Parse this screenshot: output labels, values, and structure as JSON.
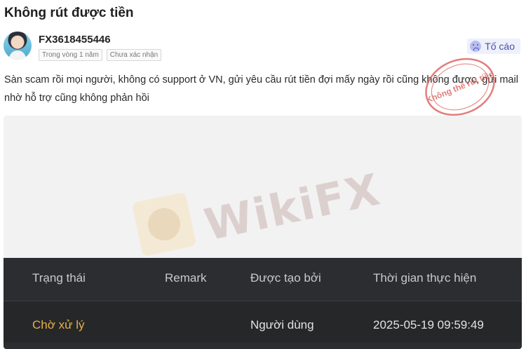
{
  "post": {
    "title": "Không rút được tiền",
    "username": "FX3618455446",
    "tags": [
      "Trong vòng 1 năm",
      "Chưa xác nhận"
    ],
    "report_label": "Tố cáo",
    "report_icon": "sad-face-icon",
    "body": "Sàn scam rồi mọi người, không có support ở VN, gửi yêu cầu rút tiền đợi mấy ngày rồi cũng không được, gửi mail nhờ hỗ trợ cũng không phản hồi",
    "stamp_text": "Không thể rút tiền"
  },
  "attachment": {
    "watermark": "WikiFX",
    "table": {
      "headers": [
        "Trạng thái",
        "Remark",
        "Được tạo bởi",
        "Thời gian thực hiện"
      ],
      "rows": [
        [
          "Chờ xử lý",
          "",
          "Người dùng",
          "2025-05-19 09:59:49"
        ]
      ]
    }
  },
  "colors": {
    "accent": "#4a4fa8",
    "pending": "#e8b04a",
    "stamp": "#d9534f",
    "table_bg": "#2b2d30"
  }
}
